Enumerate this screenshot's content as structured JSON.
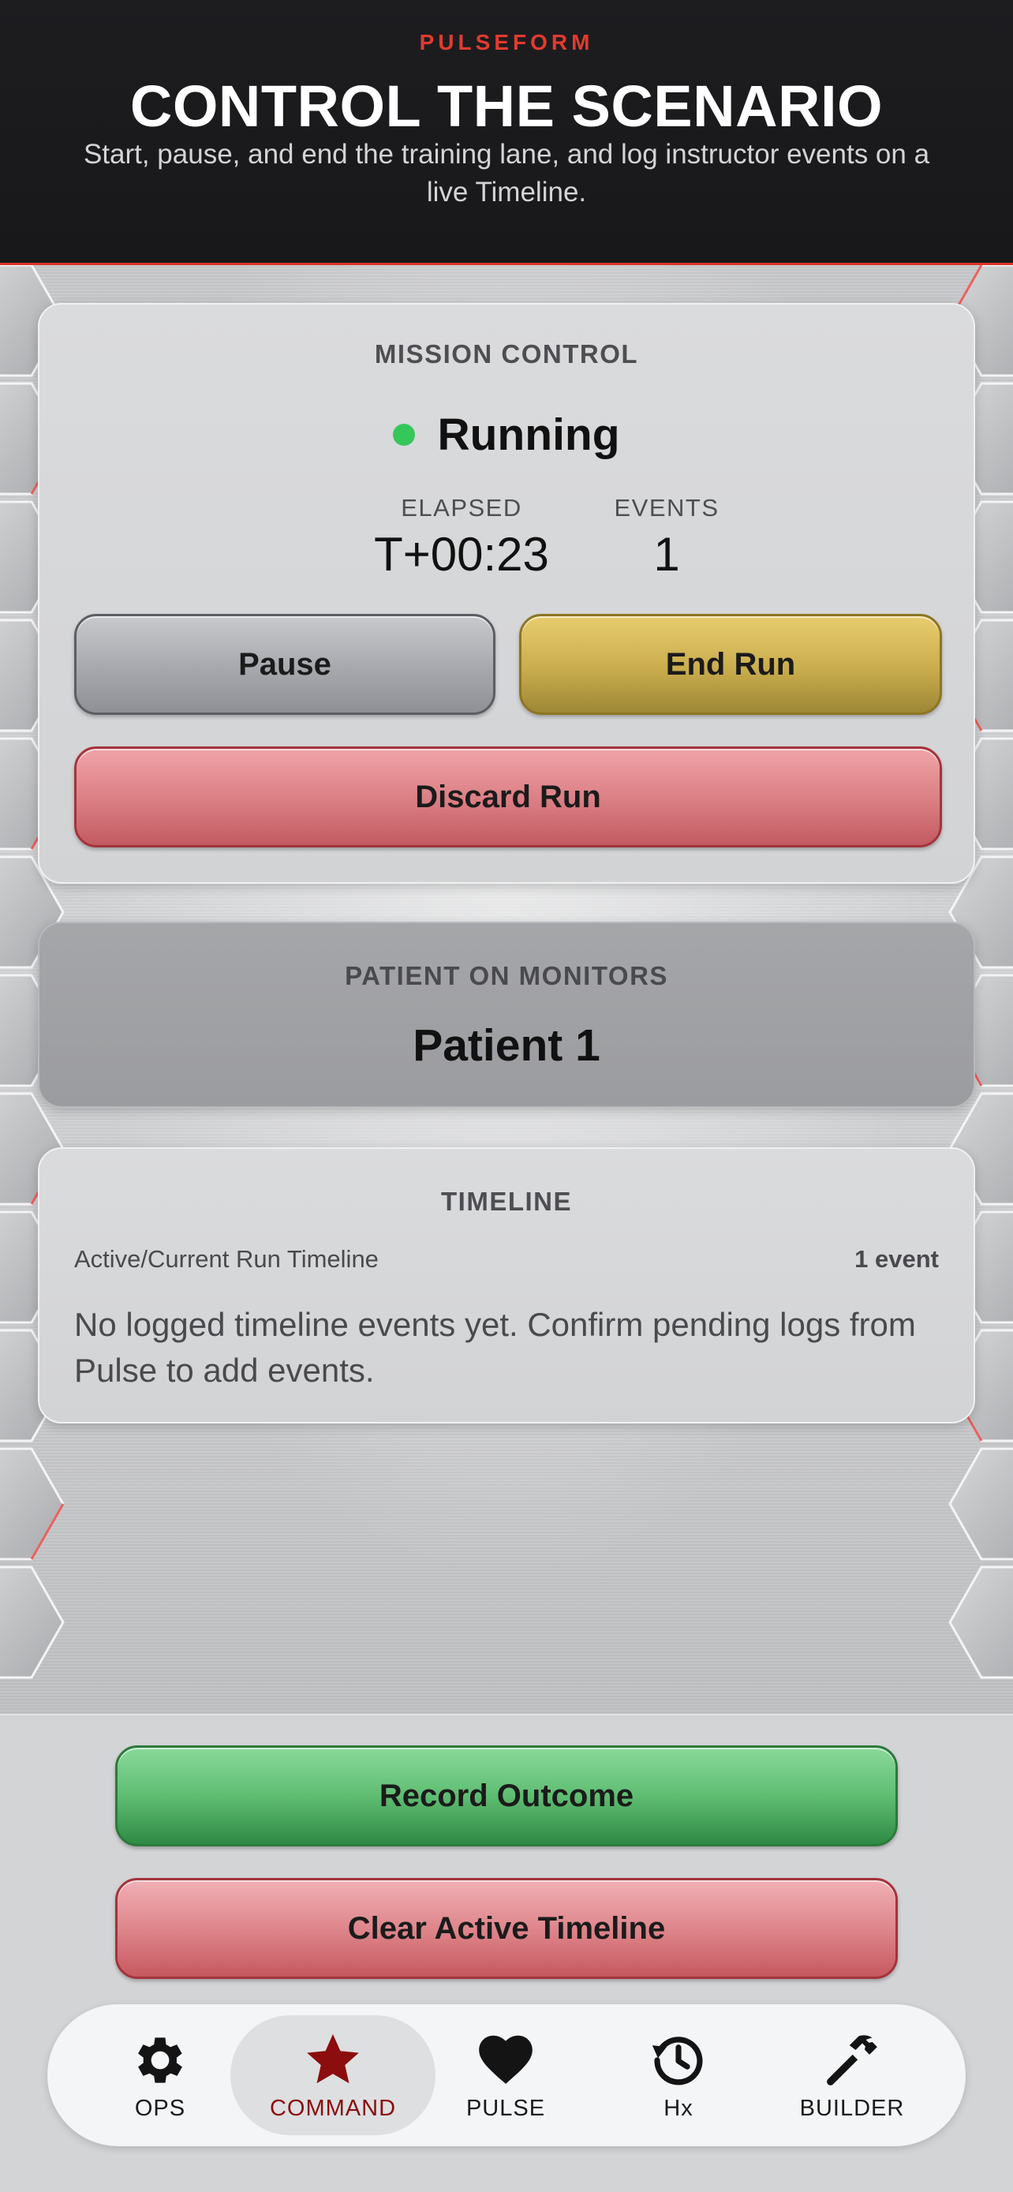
{
  "header": {
    "brand": "PULSEFORM",
    "title": "CONTROL THE SCENARIO",
    "subtitle": "Start, pause, and end the training lane, and log instructor events on a live Timeline."
  },
  "mission_control": {
    "label": "MISSION CONTROL",
    "status": "Running",
    "status_color": "#35c759",
    "elapsed_label": "ELAPSED",
    "elapsed_value": "T+00:23",
    "events_label": "EVENTS",
    "events_value": "1",
    "pause_label": "Pause",
    "end_label": "End Run",
    "discard_label": "Discard Run"
  },
  "patient": {
    "label": "PATIENT ON MONITORS",
    "name": "Patient 1"
  },
  "timeline": {
    "label": "TIMELINE",
    "subtitle": "Active/Current Run Timeline",
    "count": "1 event",
    "empty_message": "No logged timeline events yet. Confirm pending logs from Pulse to add events."
  },
  "actions": {
    "record_label": "Record Outcome",
    "clear_label": "Clear Active Timeline"
  },
  "tabs": [
    {
      "label": "OPS",
      "icon": "gear-icon"
    },
    {
      "label": "COMMAND",
      "icon": "star-icon",
      "active": true
    },
    {
      "label": "PULSE",
      "icon": "heart-icon"
    },
    {
      "label": "Hx",
      "icon": "history-icon"
    },
    {
      "label": "BUILDER",
      "icon": "hammer-icon"
    }
  ],
  "colors": {
    "brand_red": "#e23b2e",
    "active_tab": "#8b0d0d",
    "record_green": "#5fbd72",
    "danger_red": "#d87a80",
    "end_gold": "#c9ac4d"
  }
}
